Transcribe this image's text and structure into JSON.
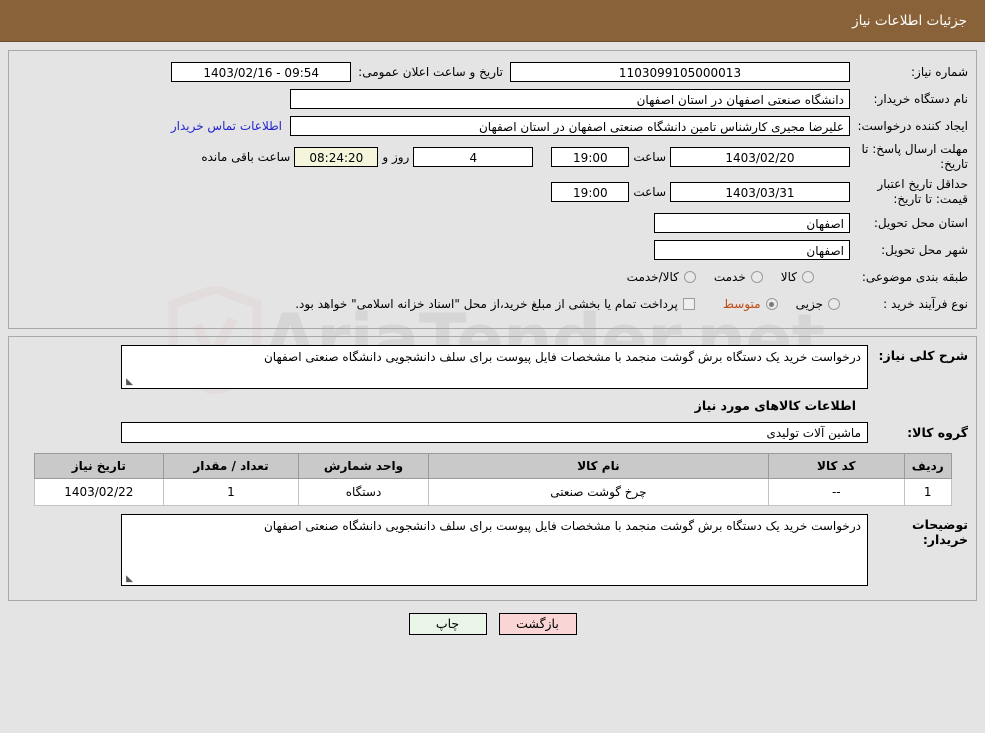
{
  "header": {
    "title": "جزئیات اطلاعات نیاز"
  },
  "watermark": {
    "text": "AriaTender.net",
    "shield_icon": "shield-icon"
  },
  "info": {
    "need_number": {
      "label": "شماره نیاز:",
      "value": "1103099105000013"
    },
    "public_announce": {
      "label": "تاریخ و ساعت اعلان عمومی:",
      "value": "1403/02/16 - 09:54"
    },
    "buyer_org": {
      "label": "نام دستگاه خریدار:",
      "value": "دانشگاه صنعتی اصفهان در استان اصفهان"
    },
    "creator": {
      "label": "ایجاد کننده درخواست:",
      "value": "علیرضا مجیری کارشناس تامین دانشگاه صنعتی اصفهان در استان اصفهان",
      "contact_link": "اطلاعات تماس خریدار"
    },
    "reply_deadline": {
      "label": "مهلت ارسال پاسخ: تا تاریخ:",
      "date": "1403/02/20",
      "time_label": "ساعت",
      "time": "19:00",
      "days": "4",
      "days_label": "روز و",
      "timer": "08:24:20",
      "timer_suffix": "ساعت باقی مانده"
    },
    "price_validity": {
      "label": "حداقل تاریخ اعتبار قیمت: تا تاریخ:",
      "date": "1403/03/31",
      "time_label": "ساعت",
      "time": "19:00"
    },
    "delivery_province": {
      "label": "استان محل تحویل:",
      "value": "اصفهان"
    },
    "delivery_city": {
      "label": "شهر محل تحویل:",
      "value": "اصفهان"
    },
    "category": {
      "label": "طبقه بندی موضوعی:",
      "options": [
        {
          "label": "کالا",
          "selected": false
        },
        {
          "label": "خدمت",
          "selected": false
        },
        {
          "label": "کالا/خدمت",
          "selected": false
        }
      ]
    },
    "purchase_type": {
      "label": "نوع فرآیند خرید :",
      "options": [
        {
          "label": "جزیی",
          "selected": false
        },
        {
          "label": "متوسط",
          "selected": true
        }
      ],
      "checkbox_note": "پرداخت تمام یا بخشی از مبلغ خرید،از محل \"اسناد خزانه اسلامی\" خواهد بود."
    }
  },
  "detail": {
    "summary": {
      "label": "شرح کلی نیاز:",
      "value": "درخواست خرید یک دستگاه برش گوشت منجمد با مشخصات فایل پیوست برای سلف دانشجویی دانشگاه صنعتی اصفهان"
    },
    "section_title": "اطلاعات کالاهای مورد نیاز",
    "goods_group": {
      "label": "گروه کالا:",
      "value": "ماشین آلات تولیدی"
    },
    "table": {
      "columns": [
        "ردیف",
        "کد کالا",
        "نام کالا",
        "واحد شمارش",
        "تعداد / مقدار",
        "تاریخ نیاز"
      ],
      "rows": [
        {
          "radif": "1",
          "code": "--",
          "name": "چرخ گوشت صنعتی",
          "unit": "دستگاه",
          "qty": "1",
          "date": "1403/02/22"
        }
      ]
    },
    "buyer_notes": {
      "label": "توضیحات خریدار:",
      "value": "درخواست خرید یک دستگاه برش گوشت منجمد با مشخصات فایل پیوست برای سلف دانشجویی دانشگاه صنعتی اصفهان"
    }
  },
  "footer": {
    "print_label": "چاپ",
    "back_label": "بازگشت"
  }
}
